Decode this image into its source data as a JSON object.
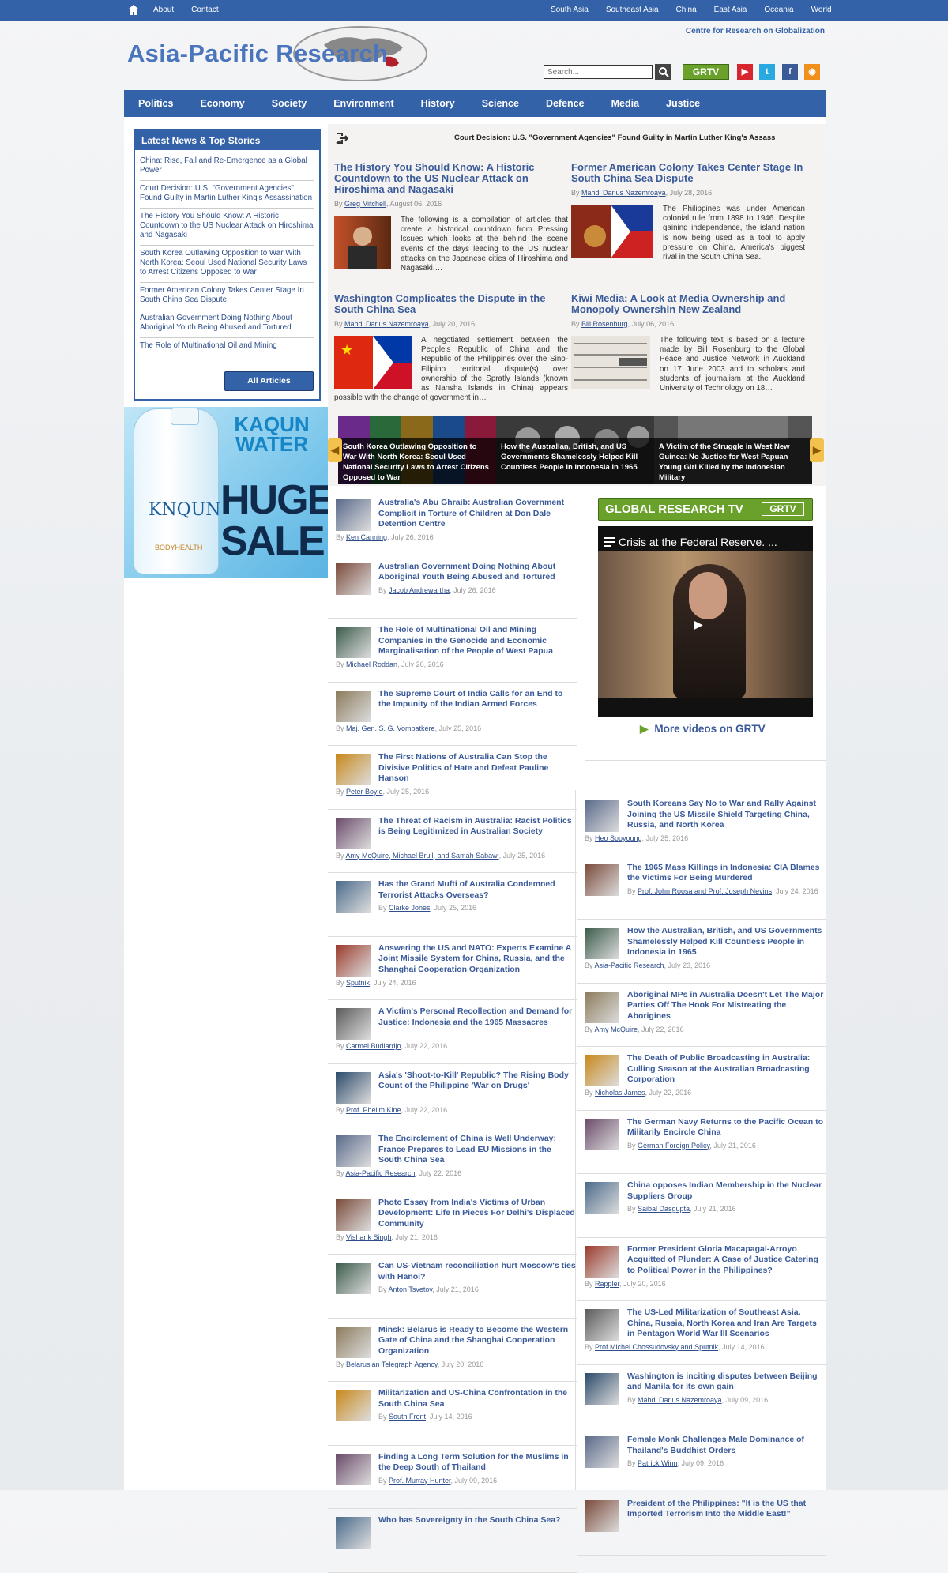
{
  "topnav": {
    "left": [
      "About",
      "Contact"
    ],
    "right": [
      "South Asia",
      "Southeast Asia",
      "China",
      "East Asia",
      "Oceania",
      "World"
    ]
  },
  "brand": {
    "title": "Asia-Pacific Research",
    "tagline": "Centre for Research on Globalization"
  },
  "search": {
    "placeholder": "Search...",
    "button_icon": "search-icon"
  },
  "social": {
    "grtv": "GRTV",
    "icons": [
      "youtube-icon",
      "twitter-icon",
      "facebook-icon",
      "rss-icon"
    ],
    "colors": {
      "youtube": "#d8262e",
      "twitter": "#2aa9e0",
      "facebook": "#3b5b98",
      "rss": "#f08f1b"
    }
  },
  "mainnav": [
    "Politics",
    "Economy",
    "Society",
    "Environment",
    "History",
    "Science",
    "Defence",
    "Media",
    "Justice"
  ],
  "latest": {
    "heading": "Latest News & Top Stories",
    "items": [
      "China: Rise, Fall and Re-Emergence as a Global Power",
      "Court Decision: U.S. \"Government Agencies\" Found Guilty in Martin Luther King's Assassination",
      "The History You Should Know: A Historic Countdown to the US Nuclear Attack on Hiroshima and Nagasaki",
      "South Korea Outlawing Opposition to War With North Korea: Seoul Used National Security Laws to Arrest Citizens Opposed to War",
      "Former American Colony Takes Center Stage In South China Sea Dispute",
      "Australian Government Doing Nothing About Aboriginal Youth Being Abused and Tortured",
      "The Role of Multinational Oil and Mining"
    ],
    "button": "All Articles"
  },
  "ad": {
    "title": "KAQUN WATER",
    "sale": "HUGE SALE",
    "brand": "KNQUN",
    "sub": "BODYHEALTH"
  },
  "headline": "Court Decision: U.S. \"Government Agencies\" Found Guilty in Martin Luther King's Assass",
  "featured": [
    {
      "title": "The History You Should Know: A Historic Countdown to the US Nuclear Attack on Hiroshima and Nagasaki",
      "by": "By",
      "author": "Greg Mitchell",
      "date": ", August 06, 2016",
      "body": "The following is a compilation of articles that create a historical countdown from Pressing Issues which looks at the behind the scene events of the days leading to the US nuclear attacks on the Japanese cities of Hiroshima and Nagasaki,…"
    },
    {
      "title": "Former American Colony Takes Center Stage In South China Sea Dispute",
      "by": "By",
      "author": "Mahdi Darius Nazemroaya",
      "date": ", July 28, 2016",
      "body": "The Philippines was under American colonial rule from 1898 to 1946. Despite gaining independence, the island nation is now being used as a tool to apply pressure on China, America's biggest rival in the South China Sea."
    },
    {
      "title": "Washington Complicates the Dispute in the South China Sea",
      "by": "By",
      "author": "Mahdi Darius Nazemroaya",
      "date": ", July 20, 2016",
      "body": "A negotiated settlement between the People's Republic of China and the Republic of the Philippines over the Sino-Filipino territorial dispute(s) over ownership of the Spratly Islands (known as Nansha Islands in China) appears possible with the change of government in…"
    },
    {
      "title": "Kiwi Media: A Look at Media Ownership and Monopoly Ownershin New Zealand",
      "by": "By",
      "author": "Bill Rosenburg",
      "date": ", July 06, 2016",
      "body": "The following text is based on a lecture made by Bill Rosenburg to the Global Peace and Justice Network in Auckland on 17 June 2003 and to scholars and students of journalism at the Auckland University of Technology on 18…"
    }
  ],
  "slider": [
    "South Korea Outlawing Opposition to War With North Korea: Seoul Used National Security Laws to Arrest Citizens Opposed to War",
    "How the Australian, British, and US Governments Shamelessly Helped Kill Countless People in Indonesia in 1965",
    "A Victim of the Struggle in West New Guinea: No Justice for West Papuan Young Girl Killed by the Indonesian Military"
  ],
  "grtv": {
    "heading": "GLOBAL RESEARCH TV",
    "badge": "GRTV",
    "video_title": "Crisis at the Federal Reserve. ...",
    "more": "More videos on GRTV"
  },
  "col_left": [
    {
      "title": "Australia's Abu Ghraib: Australian Government Complicit in Torture of Children at Don Dale Detention Centre",
      "authors": "Ken Canning",
      "date": ", July 26, 2016"
    },
    {
      "title": "Australian Government Doing Nothing About Aboriginal Youth Being Abused and Tortured",
      "authors": "Jacob Andrewartha",
      "date": ", July 26, 2016"
    },
    {
      "title": "The Role of Multinational Oil and Mining Companies in the Genocide and Economic Marginalisation of the People of West Papua",
      "authors": "Michael Roddan",
      "date": ", July 26, 2016"
    },
    {
      "title": "The Supreme Court of India Calls for an End to the Impunity of the Indian Armed Forces",
      "authors": "Maj. Gen. S. G. Vombatkere",
      "date": ", July 25, 2016"
    },
    {
      "title": "The First Nations of Australia Can Stop the Divisive Politics of Hate and Defeat Pauline Hanson",
      "authors": "Peter Boyle",
      "date": ", July 25, 2016"
    },
    {
      "title": "The Threat of Racism in Australia: Racist Politics is Being Legitimized in Australian Society",
      "authors": "Amy McQuire, Michael Brull, and Samah Sabawi",
      "date": ", July 25, 2016"
    },
    {
      "title": "Has the Grand Mufti of Australia Condemned Terrorist Attacks Overseas?",
      "authors": "Clarke Jones",
      "date": ", July 25, 2016"
    },
    {
      "title": "Answering the US and NATO: Experts Examine A Joint Missile System for China, Russia, and the Shanghai Cooperation Organization",
      "authors": "Sputnik",
      "date": ", July 24, 2016"
    },
    {
      "title": "A Victim's Personal Recollection and Demand for Justice: Indonesia and the 1965 Massacres",
      "authors": "Carmel Budiardjo",
      "date": ", July 22, 2016"
    },
    {
      "title": "Asia's 'Shoot-to-Kill' Republic? The Rising Body Count of the Philippine 'War on Drugs'",
      "authors": "Prof. Phelim Kine",
      "date": ", July 22, 2016"
    },
    {
      "title": "The Encirclement of China is Well Underway: France Prepares to Lead EU Missions in the South China Sea",
      "authors": "Asia-Pacific Research",
      "date": ", July 22, 2016"
    },
    {
      "title": "Photo Essay from India's Victims of Urban Development: Life In Pieces For Delhi's Displaced Community",
      "authors": "Vishank Singh",
      "date": ", July 21, 2016"
    },
    {
      "title": "Can US-Vietnam reconciliation hurt Moscow's ties with Hanoi?",
      "authors": "Anton Tsvetov",
      "date": ", July 21, 2016"
    },
    {
      "title": "Minsk: Belarus is Ready to Become the Western Gate of China and the Shanghai Cooperation Organization",
      "authors": "Belarusian Telegraph Agency",
      "date": ", July 20, 2016"
    },
    {
      "title": "Militarization and US-China Confrontation in the South China Sea",
      "authors": "South Front",
      "date": ", July 14, 2016"
    },
    {
      "title": "Finding a Long Term Solution for the Muslims in the Deep South of Thailand",
      "authors": "Prof. Murray Hunter",
      "date": ", July 09, 2016"
    },
    {
      "title": "Who has Sovereignty in the South China Sea?",
      "authors": "",
      "date": ""
    }
  ],
  "col_right": [
    {
      "title": "South Koreans Say No to War and Rally Against Joining the US Missile Shield Targeting China, Russia, and North Korea",
      "authors": "Heo Sooyoung",
      "date": ", July 25, 2016"
    },
    {
      "title": "The 1965 Mass Killings in Indonesia: CIA Blames the Victims For Being Murdered",
      "authors": "Prof. John Roosa and Prof. Joseph Nevins",
      "date": ", July 24, 2016"
    },
    {
      "title": "How the Australian, British, and US Governments Shamelessly Helped Kill Countless People in Indonesia in 1965",
      "authors": "Asia-Pacific Research",
      "date": ", July 23, 2016"
    },
    {
      "title": "Aboriginal MPs in Australia Doesn't Let The Major Parties Off The Hook For Mistreating the Aborigines",
      "authors": "Amy McQuire",
      "date": ", July 22, 2016"
    },
    {
      "title": "The Death of Public Broadcasting in Australia: Culling Season at the Australian Broadcasting Corporation",
      "authors": "Nicholas James",
      "date": ", July 22, 2016"
    },
    {
      "title": "The German Navy Returns to the Pacific Ocean to Militarily Encircle China",
      "authors": "German Foreign Policy",
      "date": ", July 21, 2016"
    },
    {
      "title": "China opposes Indian Membership in the Nuclear Suppliers Group",
      "authors": "Saibal Dasgupta",
      "date": ", July 21, 2016"
    },
    {
      "title": "Former President Gloria Macapagal-Arroyo Acquitted of Plunder: A Case of Justice Catering to Political Power in the Philippines?",
      "authors": "Rappler",
      "date": ", July 20, 2016"
    },
    {
      "title": "The US-Led Militarization of Southeast Asia. China, Russia, North Korea and Iran Are Targets in Pentagon World War III Scenarios",
      "authors": "Prof Michel Chossudovsky and Sputnik",
      "date": ", July 14, 2016"
    },
    {
      "title": "Washington is inciting disputes between Beijing and Manila for its own gain",
      "authors": "Mahdi Darius Nazemroaya",
      "date": ", July 09, 2016"
    },
    {
      "title": "Female Monk Challenges Male Dominance of Thailand's Buddhist Orders",
      "authors": "Patrick Winn",
      "date": ", July 09, 2016"
    },
    {
      "title": "President of the Philippines: \"It is the US that Imported Terrorism Into the Middle East!\"",
      "authors": "",
      "date": ""
    }
  ]
}
